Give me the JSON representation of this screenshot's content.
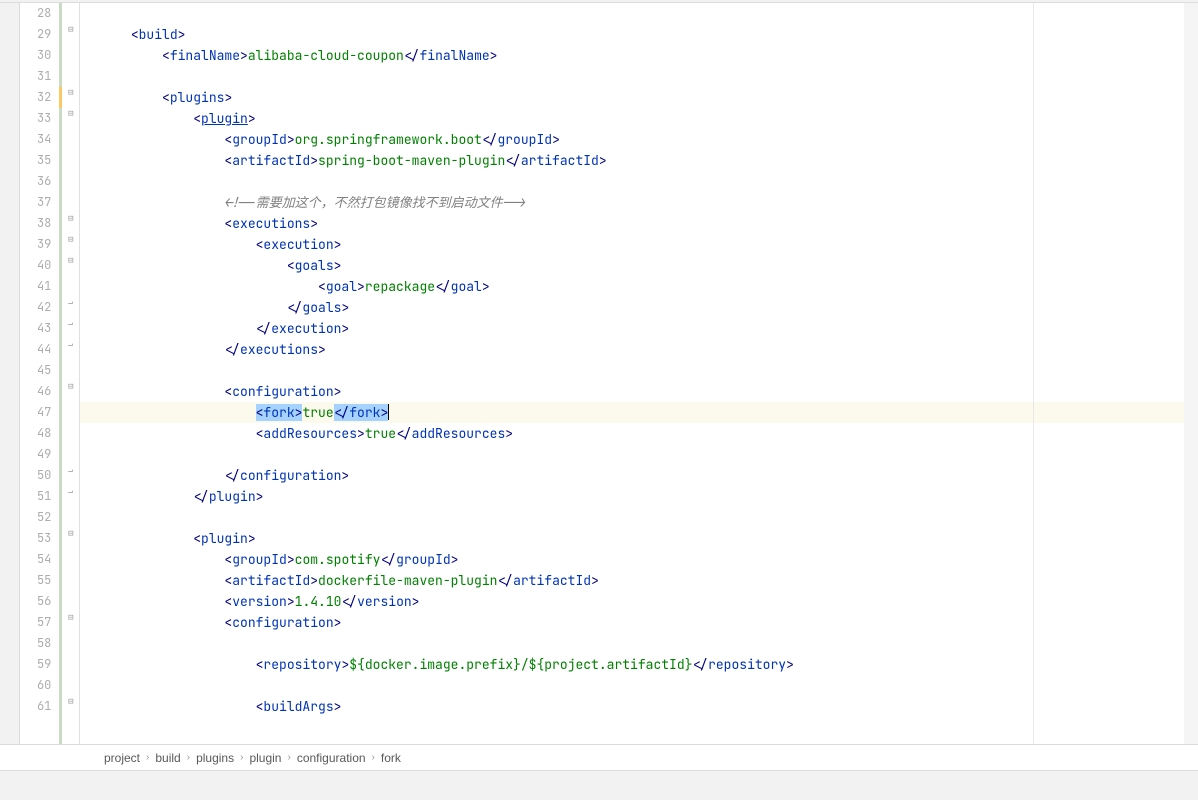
{
  "lineStart": 28,
  "lineEnd": 61,
  "highlightedLine": 47,
  "code": {
    "lines": [
      {
        "num": 28,
        "indent": 0,
        "tokens": []
      },
      {
        "num": 29,
        "indent": 1,
        "tokens": [
          {
            "t": "tag",
            "v": "<"
          },
          {
            "t": "tagname",
            "v": "build"
          },
          {
            "t": "tag",
            "v": ">"
          }
        ],
        "fold": "open"
      },
      {
        "num": 30,
        "indent": 2,
        "tokens": [
          {
            "t": "tag",
            "v": "<"
          },
          {
            "t": "tagname",
            "v": "finalName"
          },
          {
            "t": "tag",
            "v": ">"
          },
          {
            "t": "text",
            "v": "alibaba-cloud-coupon"
          },
          {
            "t": "tag",
            "v": "</"
          },
          {
            "t": "tagname",
            "v": "finalName"
          },
          {
            "t": "tag",
            "v": ">"
          }
        ]
      },
      {
        "num": 31,
        "indent": 0,
        "tokens": []
      },
      {
        "num": 32,
        "indent": 2,
        "tokens": [
          {
            "t": "tag",
            "v": "<"
          },
          {
            "t": "tagname",
            "v": "plugins"
          },
          {
            "t": "tag",
            "v": ">"
          }
        ],
        "fold": "open",
        "modified": true
      },
      {
        "num": 33,
        "indent": 3,
        "tokens": [
          {
            "t": "tag",
            "v": "<"
          },
          {
            "t": "tagname-u",
            "v": "plugin"
          },
          {
            "t": "tag",
            "v": ">"
          }
        ],
        "fold": "open"
      },
      {
        "num": 34,
        "indent": 4,
        "tokens": [
          {
            "t": "tag",
            "v": "<"
          },
          {
            "t": "tagname",
            "v": "groupId"
          },
          {
            "t": "tag",
            "v": ">"
          },
          {
            "t": "text",
            "v": "org.springframework.boot"
          },
          {
            "t": "tag",
            "v": "</"
          },
          {
            "t": "tagname",
            "v": "groupId"
          },
          {
            "t": "tag",
            "v": ">"
          }
        ]
      },
      {
        "num": 35,
        "indent": 4,
        "tokens": [
          {
            "t": "tag",
            "v": "<"
          },
          {
            "t": "tagname",
            "v": "artifactId"
          },
          {
            "t": "tag",
            "v": ">"
          },
          {
            "t": "text",
            "v": "spring-boot-maven-plugin"
          },
          {
            "t": "tag",
            "v": "</"
          },
          {
            "t": "tagname",
            "v": "artifactId"
          },
          {
            "t": "tag",
            "v": ">"
          }
        ]
      },
      {
        "num": 36,
        "indent": 0,
        "tokens": []
      },
      {
        "num": 37,
        "indent": 4,
        "tokens": [
          {
            "t": "comment",
            "v": "<!--需要加这个，不然打包镜像找不到启动文件-->"
          }
        ]
      },
      {
        "num": 38,
        "indent": 4,
        "tokens": [
          {
            "t": "tag",
            "v": "<"
          },
          {
            "t": "tagname",
            "v": "executions"
          },
          {
            "t": "tag",
            "v": ">"
          }
        ],
        "fold": "open"
      },
      {
        "num": 39,
        "indent": 5,
        "tokens": [
          {
            "t": "tag",
            "v": "<"
          },
          {
            "t": "tagname",
            "v": "execution"
          },
          {
            "t": "tag",
            "v": ">"
          }
        ],
        "fold": "open"
      },
      {
        "num": 40,
        "indent": 6,
        "tokens": [
          {
            "t": "tag",
            "v": "<"
          },
          {
            "t": "tagname",
            "v": "goals"
          },
          {
            "t": "tag",
            "v": ">"
          }
        ],
        "fold": "open"
      },
      {
        "num": 41,
        "indent": 7,
        "tokens": [
          {
            "t": "tag",
            "v": "<"
          },
          {
            "t": "tagname",
            "v": "goal"
          },
          {
            "t": "tag",
            "v": ">"
          },
          {
            "t": "text",
            "v": "repackage"
          },
          {
            "t": "tag",
            "v": "</"
          },
          {
            "t": "tagname",
            "v": "goal"
          },
          {
            "t": "tag",
            "v": ">"
          }
        ]
      },
      {
        "num": 42,
        "indent": 6,
        "tokens": [
          {
            "t": "tag",
            "v": "</"
          },
          {
            "t": "tagname",
            "v": "goals"
          },
          {
            "t": "tag",
            "v": ">"
          }
        ],
        "fold": "close"
      },
      {
        "num": 43,
        "indent": 5,
        "tokens": [
          {
            "t": "tag",
            "v": "</"
          },
          {
            "t": "tagname",
            "v": "execution"
          },
          {
            "t": "tag",
            "v": ">"
          }
        ],
        "fold": "close"
      },
      {
        "num": 44,
        "indent": 4,
        "tokens": [
          {
            "t": "tag",
            "v": "</"
          },
          {
            "t": "tagname",
            "v": "executions"
          },
          {
            "t": "tag",
            "v": ">"
          }
        ],
        "fold": "close"
      },
      {
        "num": 45,
        "indent": 0,
        "tokens": []
      },
      {
        "num": 46,
        "indent": 4,
        "tokens": [
          {
            "t": "tag",
            "v": "<"
          },
          {
            "t": "tagname",
            "v": "configuration"
          },
          {
            "t": "tag",
            "v": ">"
          }
        ],
        "fold": "open"
      },
      {
        "num": 47,
        "indent": 5,
        "tokens": [
          {
            "t": "sel-tag",
            "v": "<"
          },
          {
            "t": "sel-tagname",
            "v": "fork"
          },
          {
            "t": "sel-tag",
            "v": ">"
          },
          {
            "t": "text",
            "v": "true"
          },
          {
            "t": "sel-tag",
            "v": "</"
          },
          {
            "t": "sel-tagname",
            "v": "fork"
          },
          {
            "t": "sel-tag-caret",
            "v": ">"
          }
        ],
        "highlighted": true
      },
      {
        "num": 48,
        "indent": 5,
        "tokens": [
          {
            "t": "tag",
            "v": "<"
          },
          {
            "t": "tagname",
            "v": "addResources"
          },
          {
            "t": "tag",
            "v": ">"
          },
          {
            "t": "text",
            "v": "true"
          },
          {
            "t": "tag",
            "v": "</"
          },
          {
            "t": "tagname",
            "v": "addResources"
          },
          {
            "t": "tag",
            "v": ">"
          }
        ]
      },
      {
        "num": 49,
        "indent": 0,
        "tokens": []
      },
      {
        "num": 50,
        "indent": 4,
        "tokens": [
          {
            "t": "tag",
            "v": "</"
          },
          {
            "t": "tagname",
            "v": "configuration"
          },
          {
            "t": "tag",
            "v": ">"
          }
        ],
        "fold": "close"
      },
      {
        "num": 51,
        "indent": 3,
        "tokens": [
          {
            "t": "tag",
            "v": "</"
          },
          {
            "t": "tagname",
            "v": "plugin"
          },
          {
            "t": "tag",
            "v": ">"
          }
        ],
        "fold": "close"
      },
      {
        "num": 52,
        "indent": 0,
        "tokens": []
      },
      {
        "num": 53,
        "indent": 3,
        "tokens": [
          {
            "t": "tag",
            "v": "<"
          },
          {
            "t": "tagname",
            "v": "plugin"
          },
          {
            "t": "tag",
            "v": ">"
          }
        ],
        "fold": "open"
      },
      {
        "num": 54,
        "indent": 4,
        "tokens": [
          {
            "t": "tag",
            "v": "<"
          },
          {
            "t": "tagname",
            "v": "groupId"
          },
          {
            "t": "tag",
            "v": ">"
          },
          {
            "t": "text",
            "v": "com.spotify"
          },
          {
            "t": "tag",
            "v": "</"
          },
          {
            "t": "tagname",
            "v": "groupId"
          },
          {
            "t": "tag",
            "v": ">"
          }
        ]
      },
      {
        "num": 55,
        "indent": 4,
        "tokens": [
          {
            "t": "tag",
            "v": "<"
          },
          {
            "t": "tagname",
            "v": "artifactId"
          },
          {
            "t": "tag",
            "v": ">"
          },
          {
            "t": "text",
            "v": "dockerfile-maven-plugin"
          },
          {
            "t": "tag",
            "v": "</"
          },
          {
            "t": "tagname",
            "v": "artifactId"
          },
          {
            "t": "tag",
            "v": ">"
          }
        ]
      },
      {
        "num": 56,
        "indent": 4,
        "tokens": [
          {
            "t": "tag",
            "v": "<"
          },
          {
            "t": "tagname",
            "v": "version"
          },
          {
            "t": "tag",
            "v": ">"
          },
          {
            "t": "text",
            "v": "1.4.10"
          },
          {
            "t": "tag",
            "v": "</"
          },
          {
            "t": "tagname",
            "v": "version"
          },
          {
            "t": "tag",
            "v": ">"
          }
        ]
      },
      {
        "num": 57,
        "indent": 4,
        "tokens": [
          {
            "t": "tag",
            "v": "<"
          },
          {
            "t": "tagname",
            "v": "configuration"
          },
          {
            "t": "tag",
            "v": ">"
          }
        ],
        "fold": "open"
      },
      {
        "num": 58,
        "indent": 0,
        "tokens": []
      },
      {
        "num": 59,
        "indent": 5,
        "tokens": [
          {
            "t": "tag",
            "v": "<"
          },
          {
            "t": "tagname",
            "v": "repository"
          },
          {
            "t": "tag",
            "v": ">"
          },
          {
            "t": "text",
            "v": "${docker.image.prefix}/${project.artifactId}"
          },
          {
            "t": "tag",
            "v": "</"
          },
          {
            "t": "tagname",
            "v": "repository"
          },
          {
            "t": "tag",
            "v": ">"
          }
        ]
      },
      {
        "num": 60,
        "indent": 0,
        "tokens": []
      },
      {
        "num": 61,
        "indent": 5,
        "tokens": [
          {
            "t": "tag",
            "v": "<"
          },
          {
            "t": "tagname",
            "v": "buildArgs"
          },
          {
            "t": "tag",
            "v": ">"
          }
        ],
        "fold": "open"
      }
    ]
  },
  "breadcrumb": [
    "project",
    "build",
    "plugins",
    "plugin",
    "configuration",
    "fork"
  ]
}
